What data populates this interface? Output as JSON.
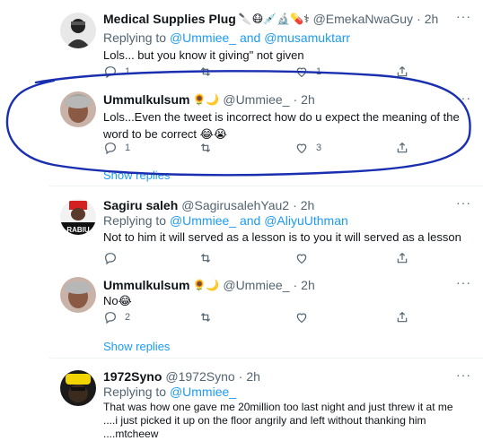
{
  "tweets": [
    {
      "name": "Medical Supplies Plug",
      "emojis": "🔪😷💉🔬💊⚕",
      "handle": "@EmekaNwaGuy",
      "time": "2h",
      "replying_label": "Replying to",
      "mention1": "@Ummiee_",
      "and": "and",
      "mention2": "@musamuktarr",
      "text": "Lols... but you know it giving\" not given",
      "reply_count": "1",
      "retweet_count": "",
      "like_count": "1"
    },
    {
      "name": "Ummulkulsum",
      "emojis": "🌻🌙",
      "handle": "@Ummiee_",
      "time": "2h",
      "text": "Lols...Even the tweet is incorrect how do u expect the meaning of the word to be correct 😂😭",
      "reply_count": "1",
      "retweet_count": "",
      "like_count": "3",
      "show_replies": "Show replies"
    },
    {
      "name": "Sagiru saleh",
      "handle": "@SagirusalehYau2",
      "time": "2h",
      "replying_label": "Replying to",
      "mention1": "@Ummiee_",
      "and": "and",
      "mention2": "@AliyuUthman",
      "text": "Not to him it will served as a lesson is to you it will served as a lesson",
      "avatar_text": "RABIU",
      "reply_count": "",
      "retweet_count": "",
      "like_count": ""
    },
    {
      "name": "Ummulkulsum",
      "emojis": "🌻🌙",
      "handle": "@Ummiee_",
      "time": "2h",
      "text": "No😂",
      "reply_count": "2",
      "retweet_count": "",
      "like_count": "",
      "show_replies": "Show replies"
    },
    {
      "name": "1972Syno",
      "handle": "@1972Syno",
      "time": "2h",
      "replying_label": "Replying to",
      "mention1": "@Ummiee_",
      "text_lines": [
        "That was how one gave me  20million too last night and just threw it at me",
        "....i just picked it up on the floor angrily and left without thanking him",
        "....mtcheew"
      ]
    }
  ],
  "colors": {
    "accent": "#1d9bf0",
    "muted": "#536471",
    "scribble": "#1a2fb0"
  },
  "icons": [
    "more-icon",
    "reply-icon",
    "retweet-icon",
    "like-icon",
    "share-icon"
  ]
}
